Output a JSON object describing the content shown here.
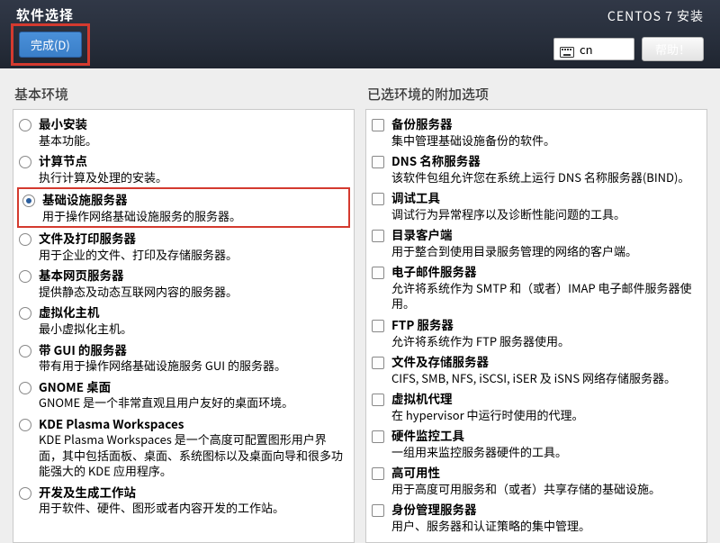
{
  "header": {
    "title": "软件选择",
    "done": "完成(D)",
    "install": "CENTOS 7 安装",
    "keyboard": "cn",
    "help": "帮助！"
  },
  "left": {
    "heading": "基本环境",
    "items": [
      {
        "title": "最小安装",
        "desc": "基本功能。",
        "selected": false
      },
      {
        "title": "计算节点",
        "desc": "执行计算及处理的安装。",
        "selected": false
      },
      {
        "title": "基础设施服务器",
        "desc": "用于操作网络基础设施服务的服务器。",
        "selected": true,
        "highlight": true
      },
      {
        "title": "文件及打印服务器",
        "desc": "用于企业的文件、打印及存储服务器。",
        "selected": false
      },
      {
        "title": "基本网页服务器",
        "desc": "提供静态及动态互联网内容的服务器。",
        "selected": false
      },
      {
        "title": "虚拟化主机",
        "desc": "最小虚拟化主机。",
        "selected": false
      },
      {
        "title": "带 GUI 的服务器",
        "desc": "带有用于操作网络基础设施服务 GUI 的服务器。",
        "selected": false
      },
      {
        "title": "GNOME 桌面",
        "desc": "GNOME 是一个非常直观且用户友好的桌面环境。",
        "selected": false
      },
      {
        "title": "KDE Plasma Workspaces",
        "desc": "KDE Plasma Workspaces 是一个高度可配置图形用户界面，其中包括面板、桌面、系统图标以及桌面向导和很多功能强大的 KDE 应用程序。",
        "selected": false
      },
      {
        "title": "开发及生成工作站",
        "desc": "用于软件、硬件、图形或者内容开发的工作站。",
        "selected": false
      }
    ]
  },
  "right": {
    "heading": "已选环境的附加选项",
    "items": [
      {
        "title": "备份服务器",
        "desc": "集中管理基础设施备份的软件。"
      },
      {
        "title": "DNS 名称服务器",
        "desc": "该软件包组允许您在系统上运行 DNS 名称服务器(BIND)。"
      },
      {
        "title": "调试工具",
        "desc": "调试行为异常程序以及诊断性能问题的工具。"
      },
      {
        "title": "目录客户端",
        "desc": "用于整合到使用目录服务管理的网络的客户端。"
      },
      {
        "title": "电子邮件服务器",
        "desc": "允许将系统作为 SMTP 和（或者）IMAP 电子邮件服务器使用。"
      },
      {
        "title": "FTP 服务器",
        "desc": "允许将系统作为 FTP 服务器使用。"
      },
      {
        "title": "文件及存储服务器",
        "desc": "CIFS, SMB, NFS, iSCSI, iSER 及 iSNS 网络存储服务器。"
      },
      {
        "title": "虚拟机代理",
        "desc": "在 hypervisor 中运行时使用的代理。"
      },
      {
        "title": "硬件监控工具",
        "desc": "一组用来监控服务器硬件的工具。"
      },
      {
        "title": "高可用性",
        "desc": "用于高度可用服务和（或者）共享存储的基础设施。"
      },
      {
        "title": "身份管理服务器",
        "desc": "用户、服务器和认证策略的集中管理。"
      }
    ]
  }
}
